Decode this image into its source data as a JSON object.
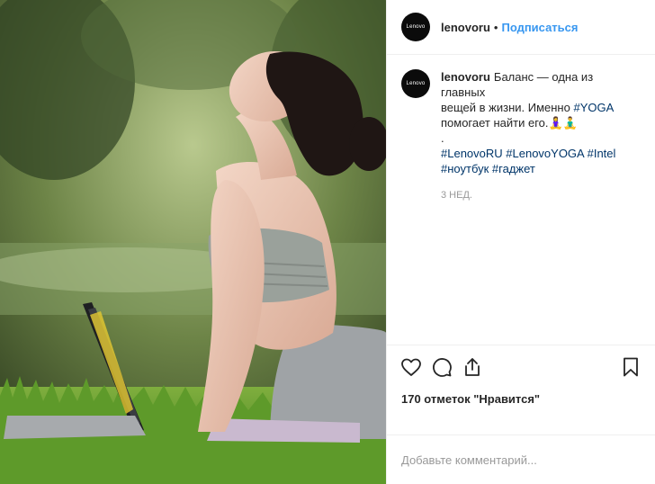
{
  "post": {
    "username": "lenovoru",
    "dot": "•",
    "follow_label": "Подписаться",
    "avatar_text": "Lenovo",
    "caption": {
      "line1": "Баланс — одна из главных",
      "line2_pre": "вещей в жизни. Именно ",
      "line2_tag": "#YOGA",
      "line3": "помогает найти его.🧘‍♀️🧘‍♂️",
      "line4": ".",
      "tags_line1": "#LenovoRU #LenovoYOGA #Intel",
      "tags_line2": "#ноутбук #гаджет"
    },
    "time_ago": "3 нед.",
    "likes": "170 отметок \"Нравится\"",
    "comment_placeholder": "Добавьте комментарий..."
  },
  "colors": {
    "link": "#3897f0",
    "hashtag": "#003569",
    "muted": "#999999",
    "border": "#efefef",
    "avatar_bg": "#0b0b0b"
  },
  "icons": [
    "heart-icon",
    "comment-icon",
    "share-icon",
    "bookmark-icon"
  ]
}
